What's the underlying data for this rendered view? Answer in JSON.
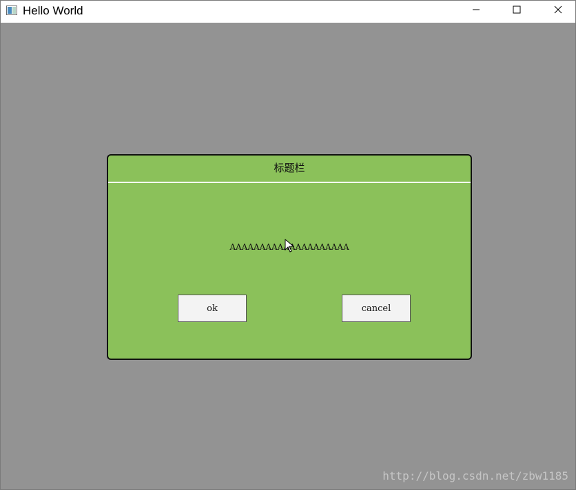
{
  "window": {
    "title": "Hello World",
    "icon": "app-window-icon",
    "controls": {
      "minimize_icon": "minimize-icon",
      "maximize_icon": "maximize-icon",
      "close_icon": "close-icon"
    }
  },
  "dialog": {
    "title": "标题栏",
    "message": "AAAAAAAAAAAAAAAAAAAA",
    "buttons": {
      "ok": "ok",
      "cancel": "cancel"
    }
  },
  "watermark": "http://blog.csdn.net/zbw1185",
  "colors": {
    "background": "#939393",
    "dialog_background": "#8bc15a",
    "dialog_border": "#111111",
    "titlebar_background": "#ffffff",
    "button_background": "#f3f3f3"
  },
  "cursor": {
    "icon": "mouse-cursor-icon"
  }
}
